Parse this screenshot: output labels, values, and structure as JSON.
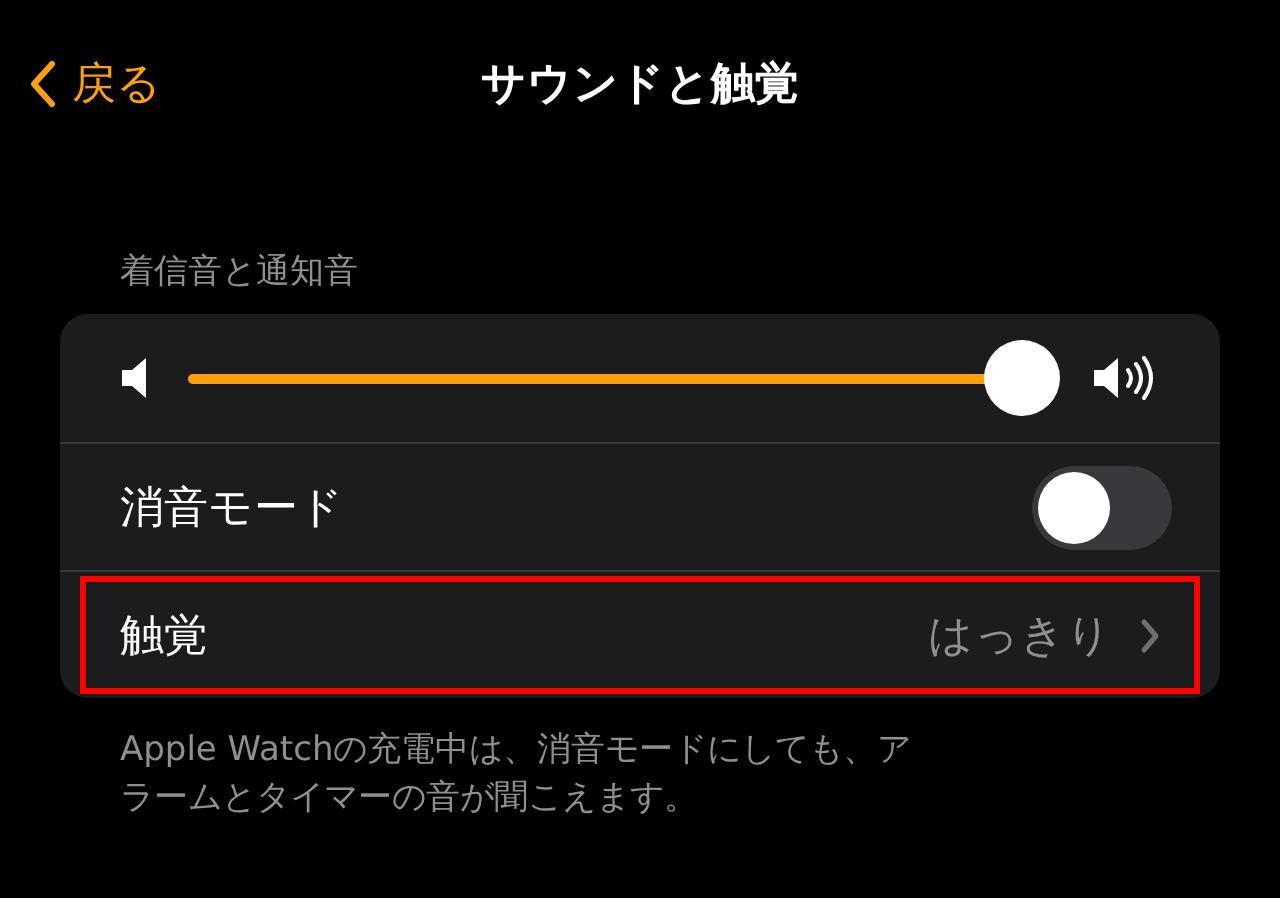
{
  "nav": {
    "back": "戻る",
    "title": "サウンドと触覚"
  },
  "section": {
    "header": "着信音と通知音",
    "rows": [
      {
        "kind": "slider",
        "level": 0.96
      },
      {
        "kind": "toggle",
        "label": "消音モード",
        "on": false
      },
      {
        "kind": "link",
        "label": "触覚",
        "value": "はっきり",
        "highlighted": true
      }
    ],
    "footer": "Apple Watchの充電中は、消音モードにしても、アラームとタイマーの音が聞こえます。"
  }
}
